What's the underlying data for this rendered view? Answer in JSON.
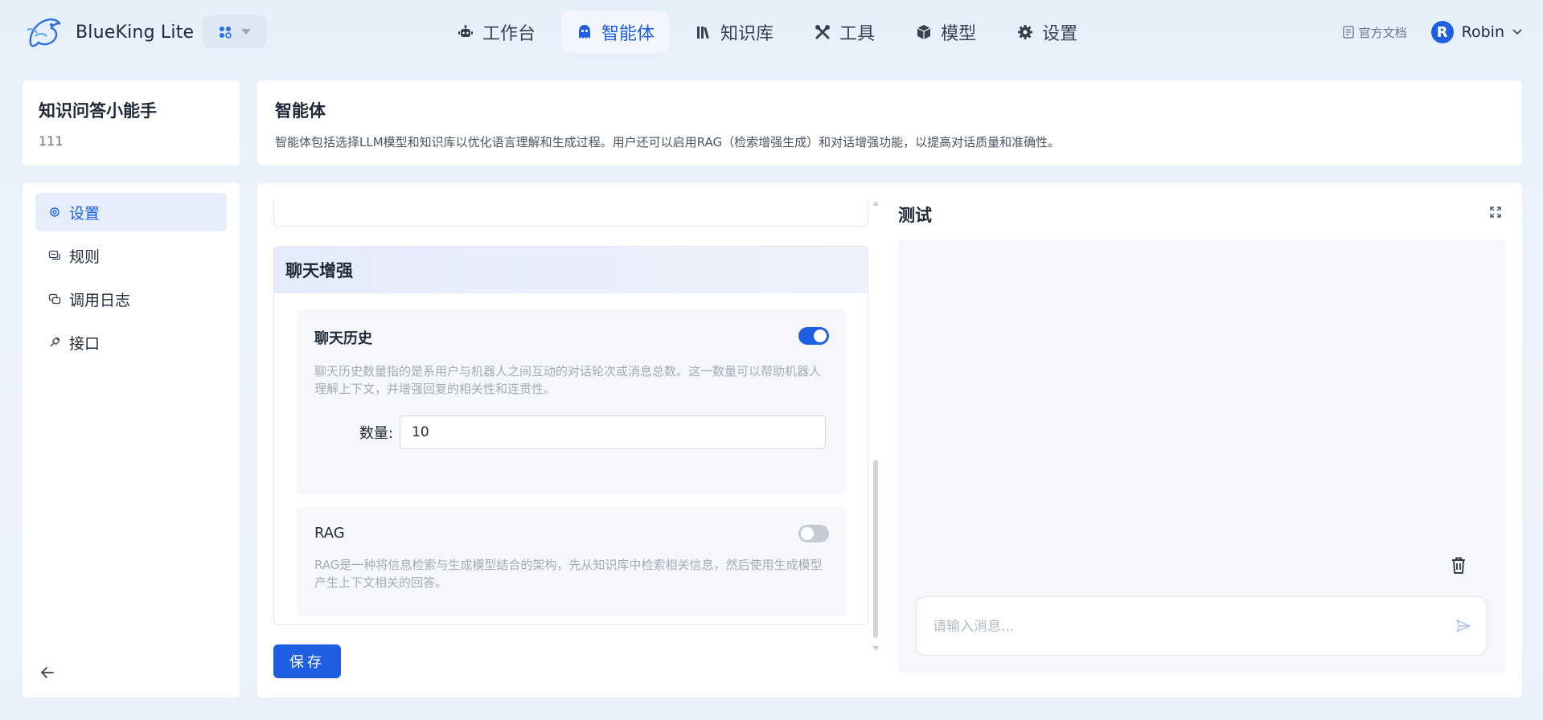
{
  "app": {
    "brand_name": "BlueKing Lite"
  },
  "nav": [
    {
      "label": "工作台",
      "icon": "robot-icon",
      "active": false
    },
    {
      "label": "智能体",
      "icon": "agent-icon",
      "active": true
    },
    {
      "label": "知识库",
      "icon": "books-icon",
      "active": false
    },
    {
      "label": "工具",
      "icon": "tools-icon",
      "active": false
    },
    {
      "label": "模型",
      "icon": "cube-icon",
      "active": false
    },
    {
      "label": "设置",
      "icon": "gear-icon",
      "active": false
    }
  ],
  "top_right": {
    "doc_link": "官方文档",
    "user_initial": "R",
    "user_name": "Robin"
  },
  "agent": {
    "name": "知识问答小能手",
    "sub": "111"
  },
  "sidebar": {
    "items": [
      {
        "label": "设置",
        "icon": "gear-icon",
        "active": true
      },
      {
        "label": "规则",
        "icon": "rules-icon",
        "active": false
      },
      {
        "label": "调用日志",
        "icon": "log-icon",
        "active": false
      },
      {
        "label": "接口",
        "icon": "api-icon",
        "active": false
      }
    ]
  },
  "header": {
    "title": "智能体",
    "description": "智能体包括选择LLM模型和知识库以优化语言理解和生成过程。用户还可以启用RAG（检索增强生成）和对话增强功能，以提高对话质量和准确性。"
  },
  "settings": {
    "section_title": "聊天增强",
    "chat_history": {
      "title": "聊天历史",
      "enabled": true,
      "description": "聊天历史数量指的是系用户与机器人之间互动的对话轮次或消息总数。这一数量可以帮助机器人理解上下文，并增强回复的相关性和连贯性。",
      "quantity_label": "数量:",
      "quantity_value": "10"
    },
    "rag": {
      "title": "RAG",
      "enabled": false,
      "description": "RAG是一种将信息检索与生成模型结合的架构，先从知识库中检索相关信息，然后使用生成模型产生上下文相关的回答。"
    },
    "save_label": "保存"
  },
  "test": {
    "title": "测试",
    "input_placeholder": "请输入消息..."
  },
  "colors": {
    "primary": "#1d5fe0",
    "toggle_off": "#c5cbd3"
  }
}
